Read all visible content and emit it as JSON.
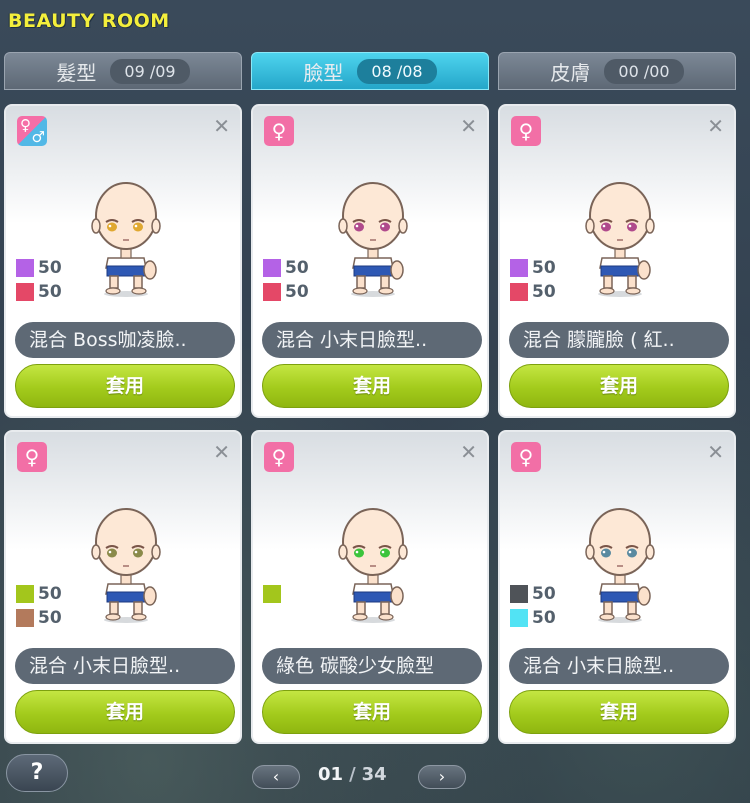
{
  "window": {
    "title": "BEAUTY ROOM"
  },
  "tabs": [
    {
      "label": "髮型",
      "count": "09 /09",
      "active": false
    },
    {
      "label": "臉型",
      "count": "08 /08",
      "active": true
    },
    {
      "label": "皮膚",
      "count": "00 /00",
      "active": false
    }
  ],
  "cards": [
    {
      "gender": "both",
      "gender_icon": "unisex-icon",
      "mix": [
        {
          "color": "#b462e6",
          "value": "50"
        },
        {
          "color": "#e44867",
          "value": "50"
        }
      ],
      "name": "混合 Boss咖凌臉..",
      "button": "套用",
      "eye_color": "#e0a830"
    },
    {
      "gender": "female",
      "gender_icon": "female-icon",
      "mix": [
        {
          "color": "#b462e6",
          "value": "50"
        },
        {
          "color": "#e44867",
          "value": "50"
        }
      ],
      "name": "混合 小末日臉型..",
      "button": "套用",
      "eye_color": "#b04a8c"
    },
    {
      "gender": "female",
      "gender_icon": "female-icon",
      "mix": [
        {
          "color": "#b462e6",
          "value": "50"
        },
        {
          "color": "#e44867",
          "value": "50"
        }
      ],
      "name": "混合 朦朧臉 ( 紅..",
      "button": "套用",
      "eye_color": "#b04a8c"
    },
    {
      "gender": "female",
      "gender_icon": "female-icon",
      "mix": [
        {
          "color": "#a3c61c",
          "value": "50"
        },
        {
          "color": "#b37a5c",
          "value": "50"
        }
      ],
      "name": "混合 小末日臉型..",
      "button": "套用",
      "eye_color": "#8a8a4a"
    },
    {
      "gender": "female",
      "gender_icon": "female-icon",
      "mix": [
        {
          "color": "#a3c61c",
          "value": ""
        }
      ],
      "name": "綠色 碳酸少女臉型",
      "button": "套用",
      "eye_color": "#3cc43c"
    },
    {
      "gender": "female",
      "gender_icon": "female-icon",
      "mix": [
        {
          "color": "#4f5358",
          "value": "50"
        },
        {
          "color": "#52e3f4",
          "value": "50"
        }
      ],
      "name": "混合 小末日臉型..",
      "button": "套用",
      "eye_color": "#5a8aa0"
    }
  ],
  "footer": {
    "help_label": "?",
    "prev_label": "‹",
    "next_label": "›",
    "page_current": "01",
    "page_sep": "/",
    "page_total": "34"
  },
  "icons": {
    "close": "close-icon",
    "female": "female-icon",
    "unisex": "unisex-icon"
  }
}
